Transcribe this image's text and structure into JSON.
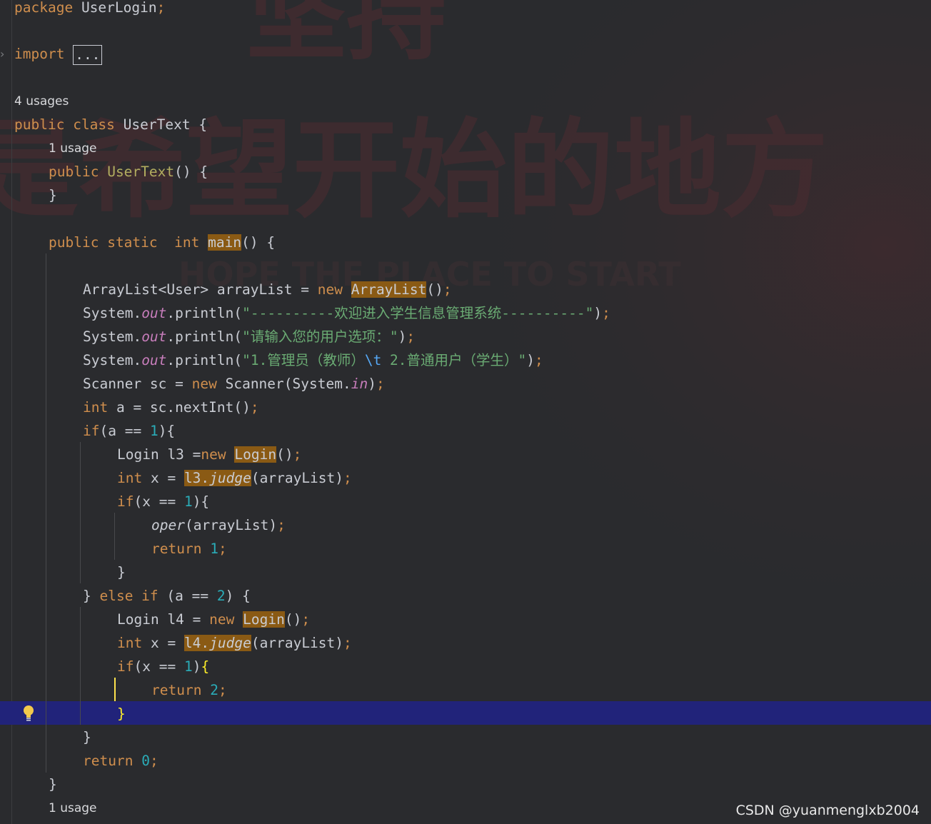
{
  "editor": {
    "package_kw": "package",
    "package_name": "UserLogin",
    "import_kw": "import",
    "import_collapsed": "...",
    "class_usages": "4 usages",
    "class_public": "public",
    "class_kw": "class",
    "class_name": "UserText",
    "ctor_usage": "1 usage",
    "ctor_public": "public",
    "ctor_name": "UserText",
    "main_public": "public",
    "main_static": "static",
    "main_int": "int",
    "main_name": "main",
    "bottom_usage": "1 usage",
    "strings": {
      "welcome": "\"----------欢迎进入学生信息管理系统----------\"",
      "prompt": "\"请输入您的用户选项：\"",
      "options_a": "\"1.管理员（教师）",
      "options_esc": "\\t",
      "options_b": " 2.普通用户（学生）\""
    },
    "numbers": {
      "one": "1",
      "two": "2",
      "zero": "0"
    }
  },
  "watermark": "CSDN @yuanmenglxb2004",
  "background_banner": {
    "top_text": "坚持",
    "main_text": "是希望开始的地方",
    "sub_text": "HOPE THE PLACE TO START"
  },
  "colors": {
    "background": "#2a2b2e",
    "keyword": "#cf8e4d",
    "string": "#6aab73",
    "number": "#2aacb8",
    "field": "#c77dbb",
    "highlight": "#8a5a14",
    "caret_line": "#21237a"
  },
  "icons": {
    "fold": "chevron-right-icon",
    "intention": "lightbulb-icon"
  }
}
